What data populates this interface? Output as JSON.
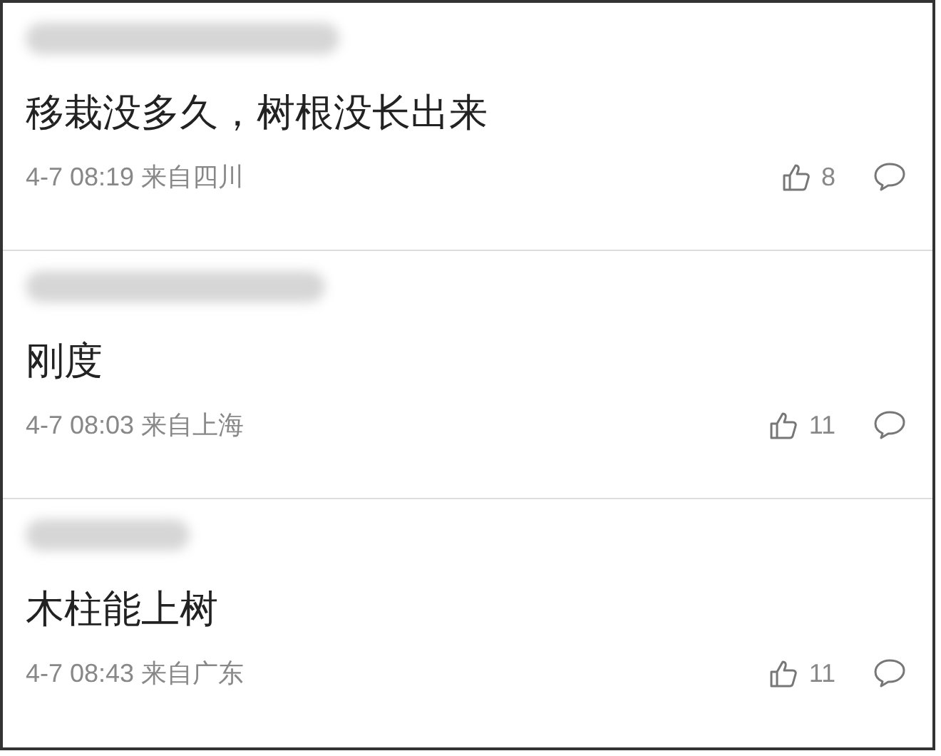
{
  "comments": [
    {
      "text": "移栽没多久，树根没长出来",
      "time": "4-7 08:19",
      "location": "来自四川",
      "likes": "8"
    },
    {
      "text": "刚度",
      "time": "4-7 08:03",
      "location": "来自上海",
      "likes": "11"
    },
    {
      "text": "木柱能上树",
      "time": "4-7 08:43",
      "location": "来自广东",
      "likes": "11"
    }
  ]
}
